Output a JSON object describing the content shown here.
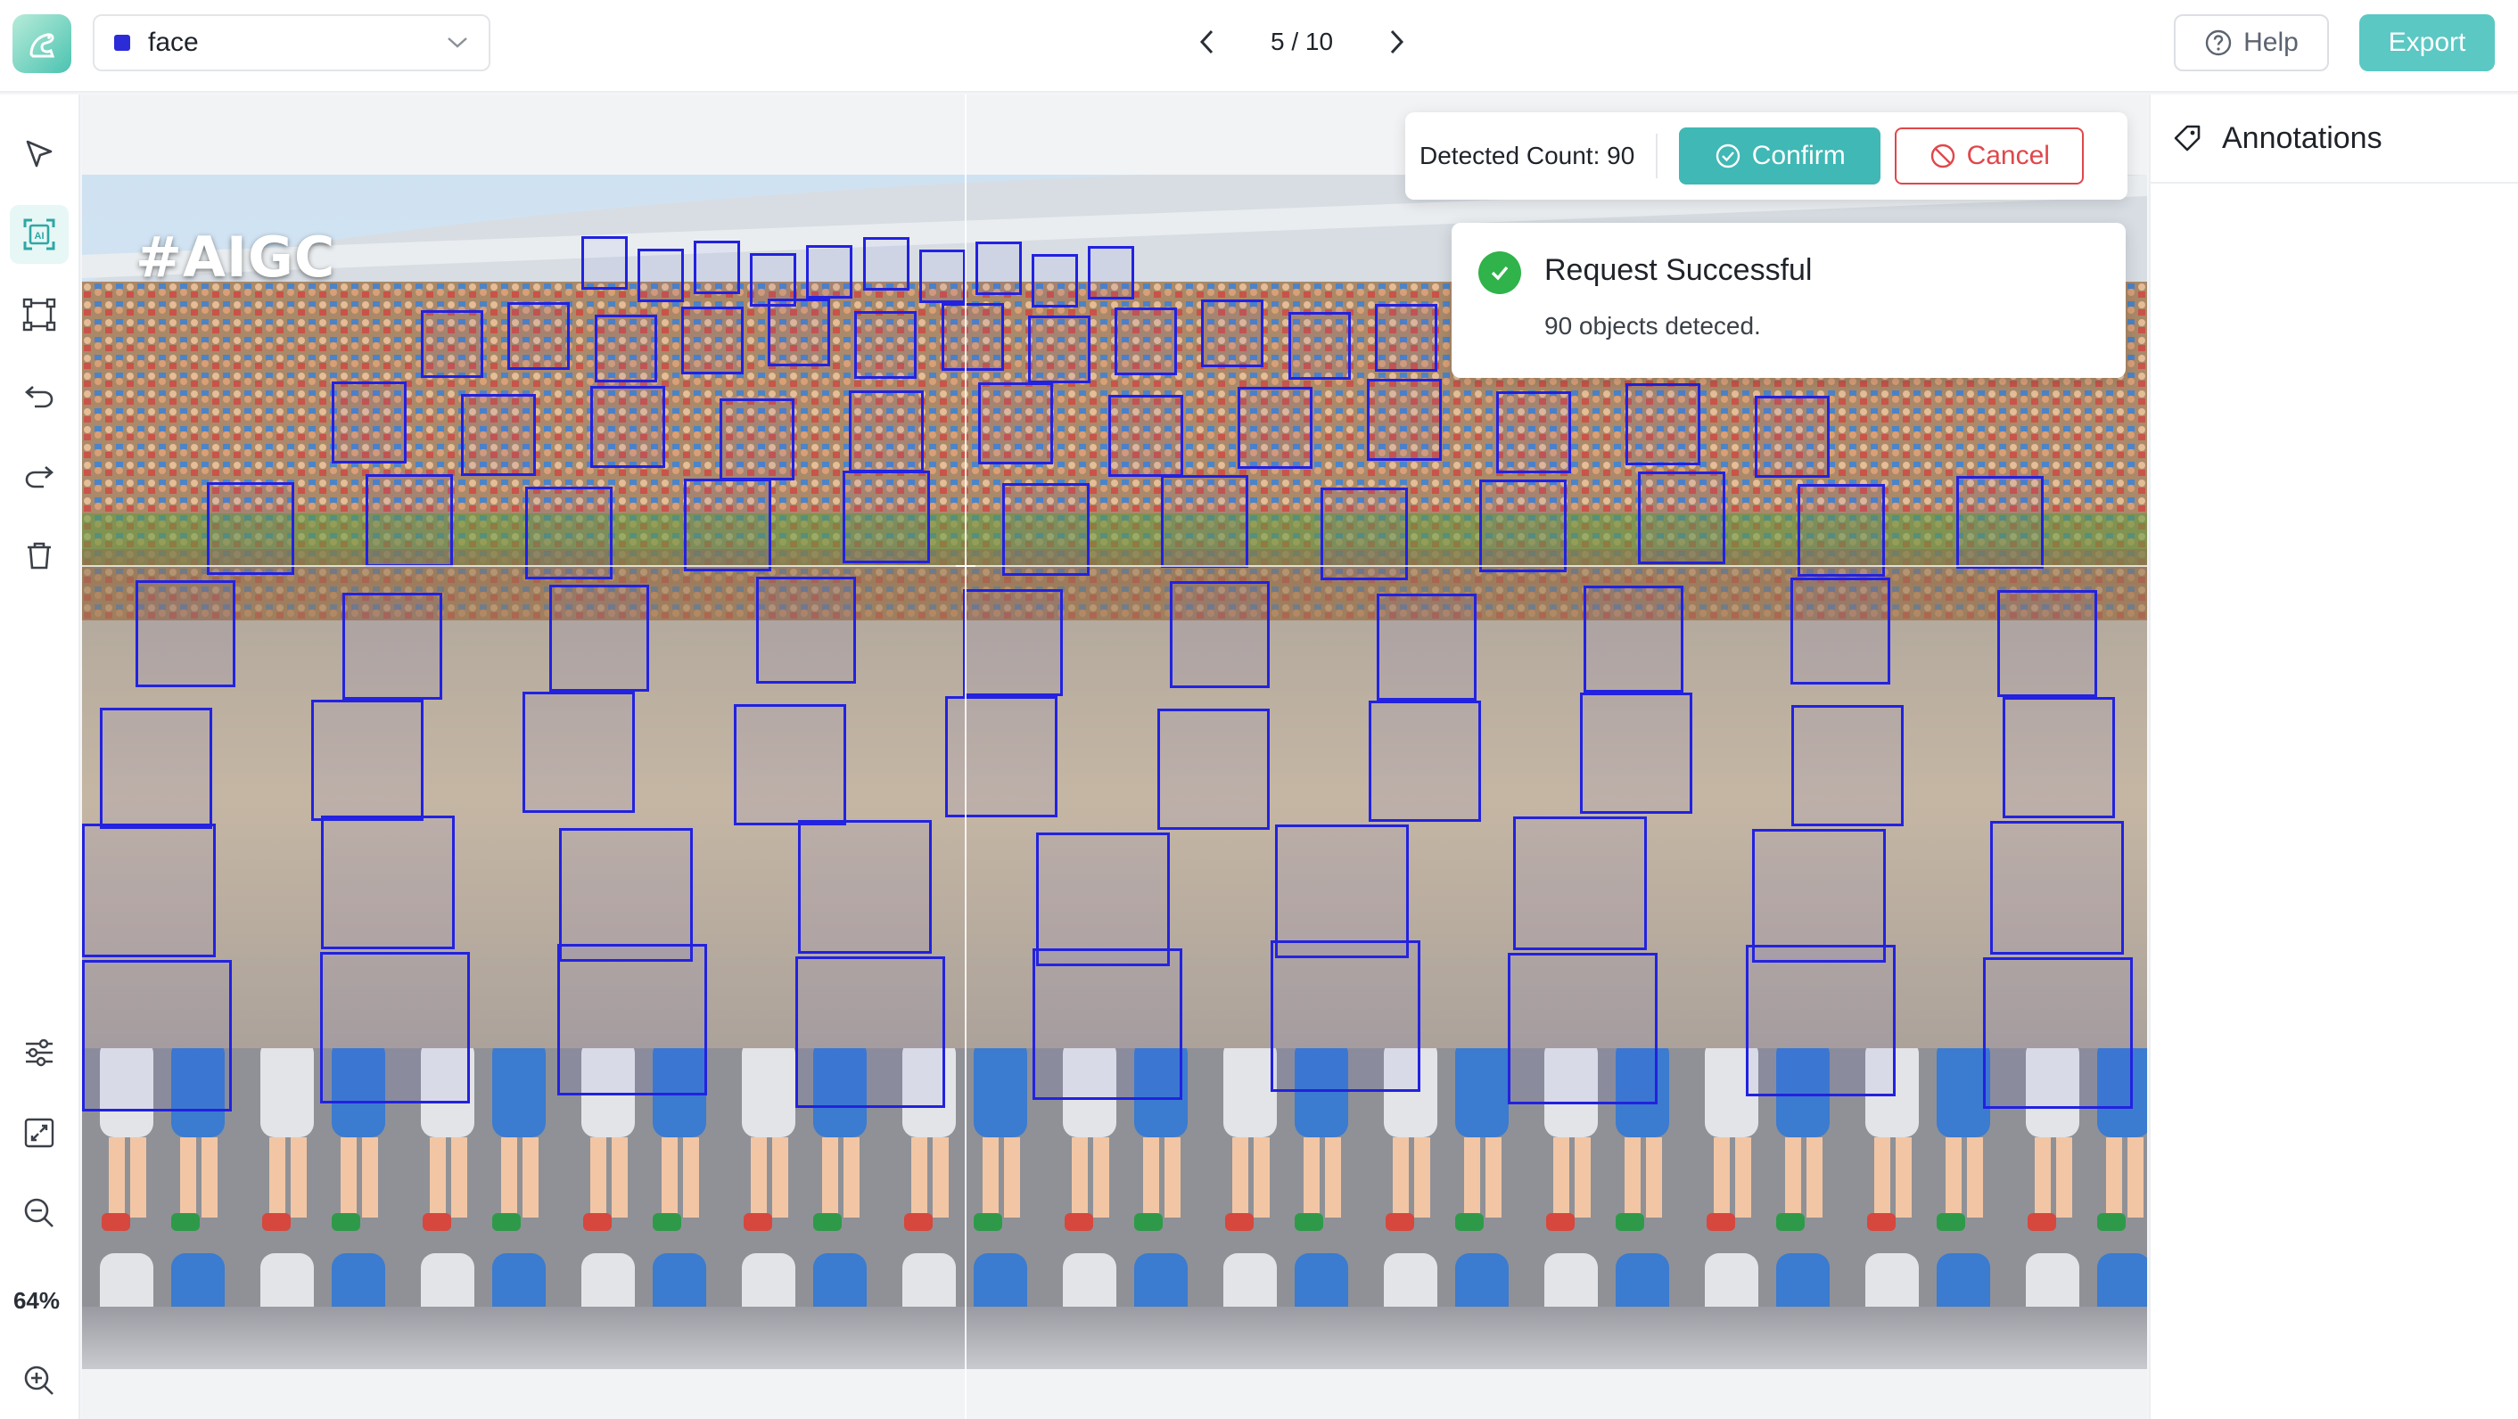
{
  "header": {
    "label_select": {
      "value": "face",
      "swatch_color": "#2b2bd8"
    },
    "pager": {
      "text": "5 / 10"
    },
    "help_label": "Help",
    "export_label": "Export"
  },
  "toolbar": {
    "tools": [
      "select-tool",
      "ai-detect-tool",
      "rectangle-tool",
      "undo",
      "redo",
      "delete"
    ],
    "active_tool": "ai-detect-tool",
    "bottom_tools": [
      "settings",
      "fit-screen",
      "zoom-out",
      "zoom-in"
    ],
    "zoom_level": "64%"
  },
  "canvas": {
    "watermark": "#AIGC",
    "box_color": "#2222e0"
  },
  "detection": {
    "count_text": "Detected Count: 90",
    "confirm_label": "Confirm",
    "cancel_label": "Cancel"
  },
  "notification": {
    "title": "Request Successful",
    "message": "90 objects deteced."
  },
  "right_panel": {
    "title": "Annotations"
  },
  "colors": {
    "accent": "#5bc8c4",
    "confirm": "#40b8b5",
    "cancel": "#e0474a",
    "success": "#2fb34a"
  }
}
